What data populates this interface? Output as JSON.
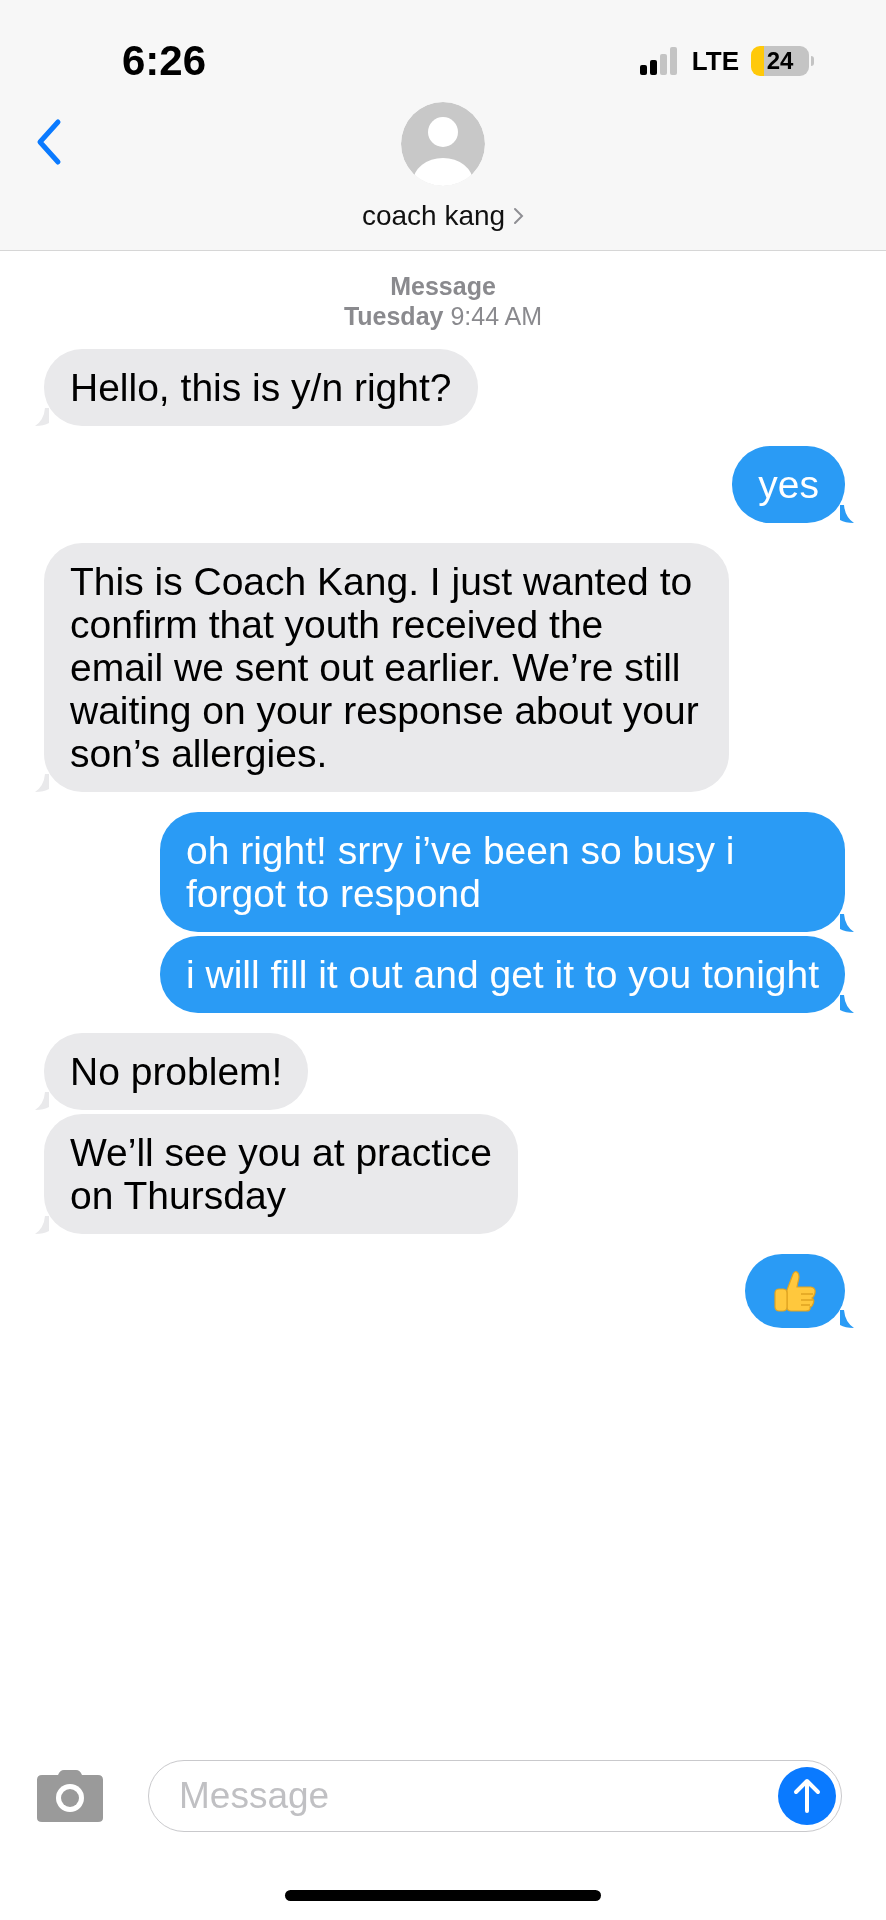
{
  "status_bar": {
    "time": "6:26",
    "network": "LTE",
    "battery": "24"
  },
  "contact": {
    "name": "coach kang"
  },
  "thread": {
    "service": "Message",
    "timestamp": "**Tuesday** 9:44 AM"
  },
  "messages": [
    {
      "outgoing": false,
      "kind": "text",
      "text": "Hello, this is y/n right?"
    },
    {
      "outgoing": true,
      "kind": "text",
      "text": "yes"
    },
    {
      "outgoing": false,
      "kind": "text",
      "text": "This is Coach Kang. I just wanted to confirm that youth received the email we sent out earlier. We’re still waiting on your response about your son’s allergies."
    },
    {
      "outgoing": true,
      "kind": "text",
      "text": "oh right! srry i’ve been so busy i forgot to respond"
    },
    {
      "outgoing": true,
      "kind": "text",
      "text": "i will fill it out and get it to you tonight"
    },
    {
      "outgoing": false,
      "kind": "text",
      "text": "No problem!"
    },
    {
      "outgoing": false,
      "kind": "text",
      "text": "We’ll see you at practice\non Thursday"
    },
    {
      "outgoing": true,
      "kind": "thumbs-up"
    }
  ],
  "compose": {
    "placeholder": "Message"
  }
}
